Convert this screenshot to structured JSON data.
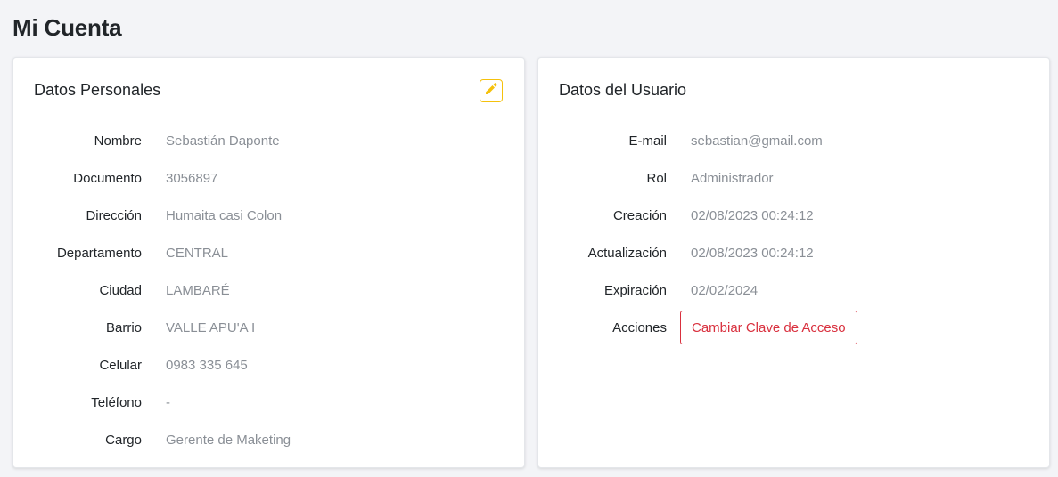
{
  "page_title": "Mi Cuenta",
  "personal": {
    "title": "Datos Personales",
    "edit_icon": "pencil-icon",
    "rows": [
      {
        "label": "Nombre",
        "value": "Sebastián Daponte"
      },
      {
        "label": "Documento",
        "value": "3056897"
      },
      {
        "label": "Dirección",
        "value": "Humaita casi Colon"
      },
      {
        "label": "Departamento",
        "value": "CENTRAL"
      },
      {
        "label": "Ciudad",
        "value": "LAMBARÉ"
      },
      {
        "label": "Barrio",
        "value": "VALLE APU'A I"
      },
      {
        "label": "Celular",
        "value": "0983 335 645"
      },
      {
        "label": "Teléfono",
        "value": "-"
      },
      {
        "label": "Cargo",
        "value": "Gerente de Maketing"
      }
    ]
  },
  "user": {
    "title": "Datos del Usuario",
    "rows": [
      {
        "label": "E-mail",
        "value": "sebastian@gmail.com"
      },
      {
        "label": "Rol",
        "value": "Administrador"
      },
      {
        "label": "Creación",
        "value": "02/08/2023 00:24:12"
      },
      {
        "label": "Actualización",
        "value": "02/08/2023 00:24:12"
      },
      {
        "label": "Expiración",
        "value": "02/02/2024"
      }
    ],
    "actions_label": "Acciones",
    "change_password_label": "Cambiar Clave de Acceso"
  },
  "colors": {
    "edit_accent": "#f5c10c",
    "danger": "#d9303e"
  }
}
